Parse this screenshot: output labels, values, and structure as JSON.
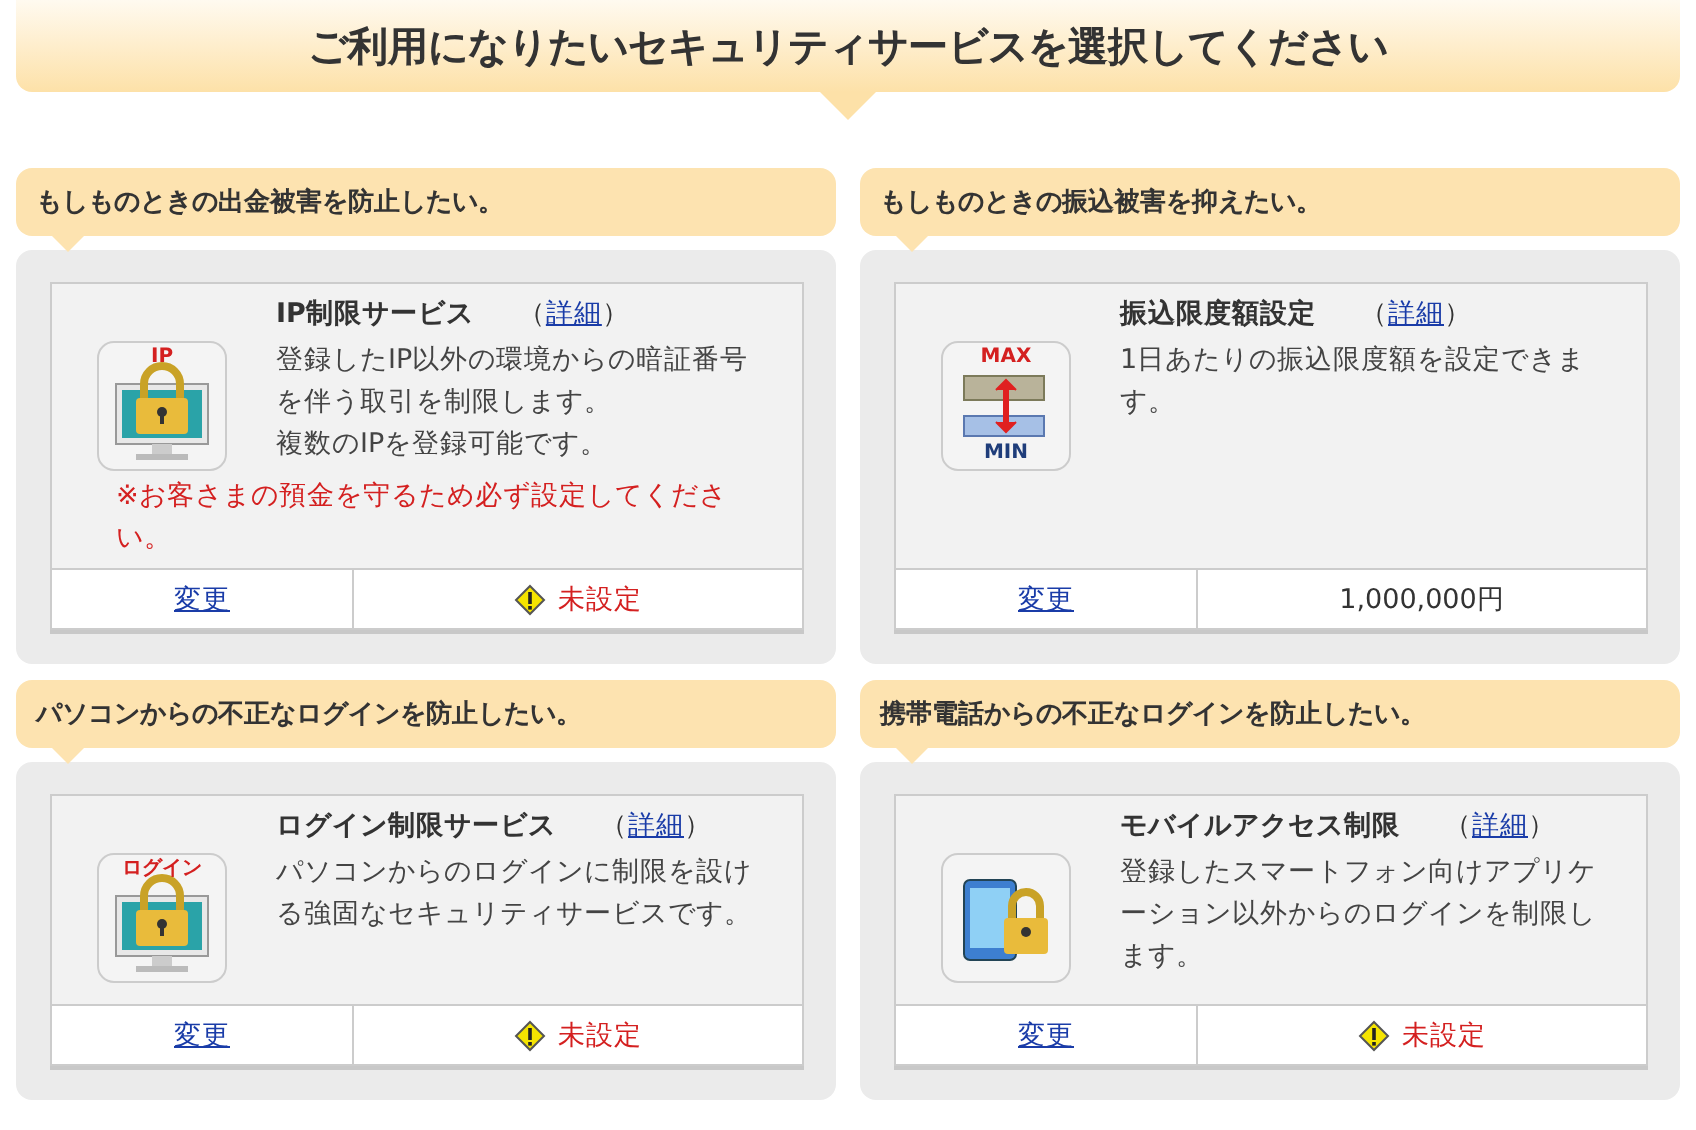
{
  "banner": {
    "title": "ご利用になりたいセキュリティサービスを選択してください"
  },
  "sections": [
    {
      "heading": "もしものときの出金被害を防止したい。",
      "service": {
        "kind": "monitor-lock",
        "icon_labels": [
          "IP"
        ],
        "title": "IP制限サービス",
        "bracket_open": "（",
        "detail_link": "詳細",
        "bracket_close": "）",
        "description": [
          "登録したIP以外の環境からの暗証番号を伴う取引を制限します。",
          "複数のIPを登録可能です。"
        ],
        "notice": "※お客さまの預金を守るため必ず設定してください。",
        "change_link": "変更",
        "status": {
          "kind": "warning",
          "text": "未設定"
        }
      }
    },
    {
      "heading": "もしものときの振込被害を抑えたい。",
      "service": {
        "kind": "transfer-limit",
        "icon_labels": [
          "MAX",
          "MIN"
        ],
        "title": "振込限度額設定",
        "bracket_open": "（",
        "detail_link": "詳細",
        "bracket_close": "）",
        "description": [
          "1日あたりの振込限度額を設定できます。"
        ],
        "change_link": "変更",
        "status": {
          "kind": "value",
          "text": "1,000,000円"
        }
      }
    },
    {
      "heading": "パソコンからの不正なログインを防止したい。",
      "service": {
        "kind": "monitor-lock",
        "icon_labels": [
          "ログイン"
        ],
        "title": "ログイン制限サービス",
        "bracket_open": "（",
        "detail_link": "詳細",
        "bracket_close": "）",
        "description": [
          "パソコンからのログインに制限を設ける強固なセキュリティサービスです。"
        ],
        "change_link": "変更",
        "status": {
          "kind": "warning",
          "text": "未設定"
        }
      }
    },
    {
      "heading": "携帯電話からの不正なログインを防止したい。",
      "service": {
        "kind": "phone-lock",
        "title": "モバイルアクセス制限",
        "bracket_open": "（",
        "detail_link": "詳細",
        "bracket_close": "）",
        "description": [
          "登録したスマートフォン向けアプリケーション以外からのログインを制限します。"
        ],
        "change_link": "変更",
        "status": {
          "kind": "warning",
          "text": "未設定"
        }
      }
    }
  ]
}
